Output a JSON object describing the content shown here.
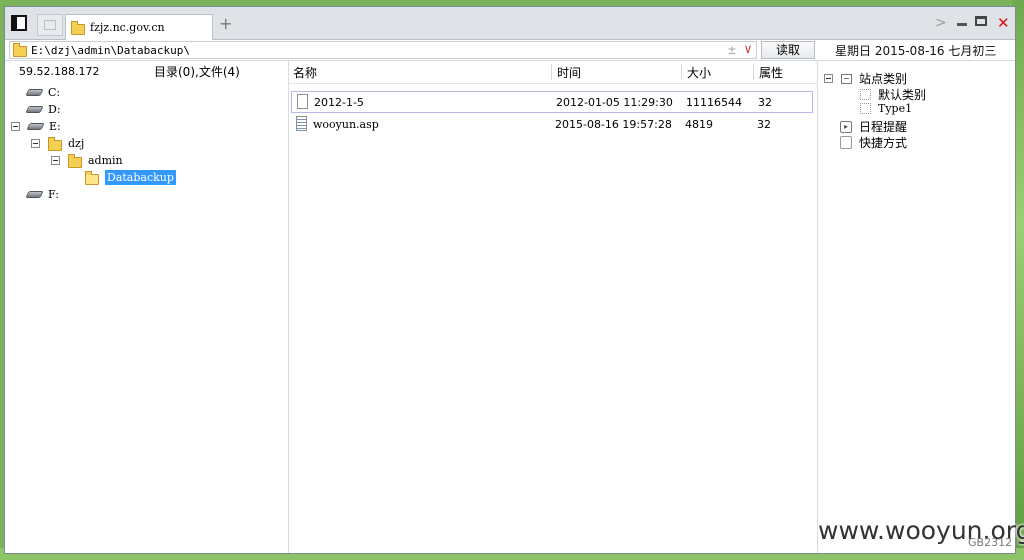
{
  "tabs": {
    "active_label": "fzjz.nc.gov.cn",
    "new_tab_label": "+"
  },
  "address": {
    "path": "E:\\dzj\\admin\\Databackup\\",
    "plus_glyph": "±",
    "dropdown_glyph": "∨",
    "read_button": "读取"
  },
  "date_display": "星期日  2015-08-16  七月初三",
  "left": {
    "ip": "59.52.188.172",
    "counts": "目录(0),文件(4)",
    "tree": [
      {
        "label": "C:"
      },
      {
        "label": "D:"
      },
      {
        "label": "E:"
      },
      {
        "label": "dzj"
      },
      {
        "label": "admin"
      },
      {
        "label": "Databackup"
      },
      {
        "label": "F:"
      }
    ]
  },
  "files": {
    "columns": [
      "名称",
      "时间",
      "大小",
      "属性"
    ],
    "rows": [
      {
        "name": "2012-1-5",
        "time": "2012-01-05 11:29:30",
        "size": "11116544",
        "attr": "32"
      },
      {
        "name": "wooyun.asp",
        "time": "2015-08-16 19:57:28",
        "size": "4819",
        "attr": "32"
      }
    ]
  },
  "right": {
    "site_category": "站点类别",
    "default_category": "默认类别",
    "type1": "Type1",
    "schedule": "日程提醒",
    "shortcuts": "快捷方式"
  },
  "watermark": "www.wooyun.org",
  "encoding": "GB2312"
}
